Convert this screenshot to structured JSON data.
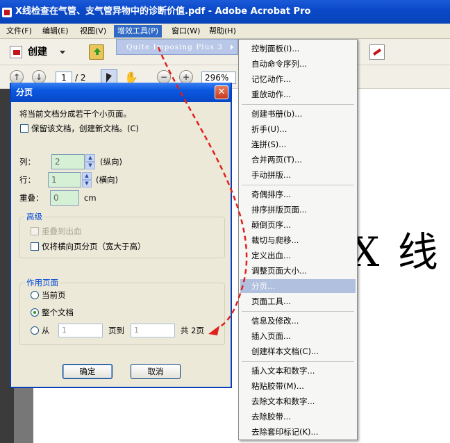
{
  "window": {
    "title": "X线检查在气管、支气管异物中的诊断价值.pdf - Adobe Acrobat Pro"
  },
  "menubar": [
    {
      "label": "文件(F)"
    },
    {
      "label": "编辑(E)"
    },
    {
      "label": "视图(V)"
    },
    {
      "label": "增效工具(P)",
      "active": true
    },
    {
      "label": "窗口(W)"
    },
    {
      "label": "帮助(H)"
    }
  ],
  "toolbar": {
    "create_label": "创建",
    "page_current": "1",
    "page_total": "/ 2",
    "zoom": "296%"
  },
  "document": {
    "visible_text": "X 线"
  },
  "plugin_menu": {
    "item": "Quite Imposing Plus 3"
  },
  "submenu": {
    "items": [
      "控制面板(I)...",
      "自动命令序列...",
      "记忆动作...",
      "重放动作...",
      "创建书册(b)...",
      "折手(U)...",
      "连拼(S)...",
      "合并两页(T)...",
      "手动拼版...",
      "奇偶排序...",
      "排序拼版页面...",
      "颠倒页序...",
      "裁切与爬移...",
      "定义出血...",
      "调整页面大小...",
      "分页...",
      "页面工具...",
      "信息及修改...",
      "插入页面...",
      "创建样本文档(C)...",
      "插入文本和数字...",
      "粘贴胶带(M)...",
      "去除文本和数字...",
      "去除胶带...",
      "去除套印标记(K)..."
    ],
    "selected": "分页..."
  },
  "dialog": {
    "title": "分页",
    "close_label": "✕",
    "intro": "将当前文档分成若干个小页面。",
    "keep_doc_label": "保留该文档，创建新文档。(C)",
    "columns_label": "列：",
    "columns_value": "2",
    "columns_hint": "(纵向)",
    "rows_label": "行：",
    "rows_value": "1",
    "rows_hint": "(横向)",
    "overlap_label": "重叠：",
    "overlap_value": "0",
    "overlap_unit": "cm",
    "advanced": {
      "label": "高级",
      "overlap_bleed_label": "重叠到出血",
      "landscape_only_label": "仅将横向页分页（宽大于高）"
    },
    "pages": {
      "label": "作用页面",
      "current_label": "当前页",
      "all_label": "整个文档",
      "from_label": "从",
      "from_value": "1",
      "to_label": "页到",
      "to_value": "1",
      "total_label": "共 2页"
    },
    "ok_label": "确定",
    "cancel_label": "取消"
  },
  "colors": {
    "title_blue": "#0a49c9",
    "menu_selected": "#b0c0de",
    "arrow_red": "#e0201c"
  },
  "icons": [
    "create-icon",
    "open-folder-icon",
    "sign-icon",
    "prev-page-icon",
    "next-page-icon",
    "select-icon",
    "hand-icon",
    "zoom-out-icon",
    "zoom-in-icon",
    "close-icon"
  ]
}
